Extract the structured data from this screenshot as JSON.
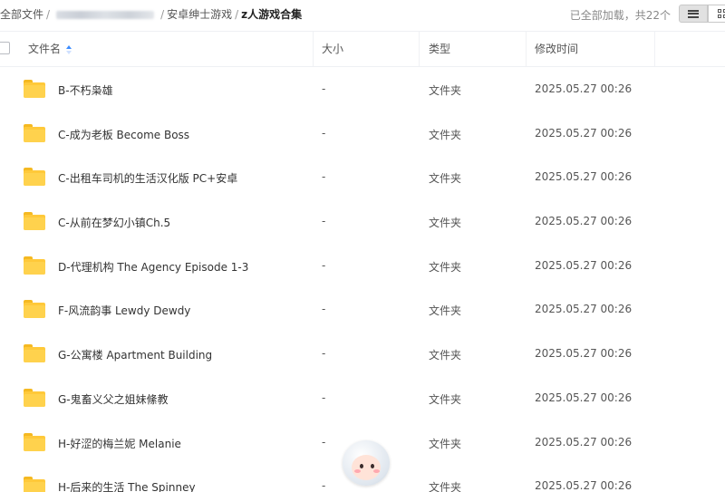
{
  "breadcrumb": {
    "root": "全部文件",
    "separator": "/",
    "parent": "安卓绅士游戏",
    "current": "z人游戏合集"
  },
  "load_status": "已全部加载，共22个",
  "view_modes": [
    "list-icon",
    "grid-icon"
  ],
  "columns": {
    "name": "文件名",
    "size": "大小",
    "type": "类型",
    "modified": "修改时间"
  },
  "files": [
    {
      "name": "B-不朽枭雄",
      "size": "-",
      "type": "文件夹",
      "modified": "2025.05.27 00:26"
    },
    {
      "name": "C-成为老板 Become Boss",
      "size": "-",
      "type": "文件夹",
      "modified": "2025.05.27 00:26"
    },
    {
      "name": "C-出租车司机的生活汉化版 PC+安卓",
      "size": "-",
      "type": "文件夹",
      "modified": "2025.05.27 00:26"
    },
    {
      "name": "C-从前在梦幻小镇Ch.5",
      "size": "-",
      "type": "文件夹",
      "modified": "2025.05.27 00:26"
    },
    {
      "name": "D-代理机构 The Agency Episode 1-3",
      "size": "-",
      "type": "文件夹",
      "modified": "2025.05.27 00:26"
    },
    {
      "name": "F-风流韵事 Lewdy Dewdy",
      "size": "-",
      "type": "文件夹",
      "modified": "2025.05.27 00:26"
    },
    {
      "name": "G-公寓楼 Apartment Building",
      "size": "-",
      "type": "文件夹",
      "modified": "2025.05.27 00:26"
    },
    {
      "name": "G-鬼畜义父之姐妹絛教",
      "size": "-",
      "type": "文件夹",
      "modified": "2025.05.27 00:26"
    },
    {
      "name": "H-好涩的梅兰妮 Melanie",
      "size": "-",
      "type": "文件夹",
      "modified": "2025.05.27 00:26"
    },
    {
      "name": "H-后来的生活 The Spinney",
      "size": "-",
      "type": "文件夹",
      "modified": "2025.05.27 00:26"
    }
  ],
  "colors": {
    "folder": "#ffc93a",
    "sort_active": "#3b8cff",
    "muted_text": "#888888"
  }
}
